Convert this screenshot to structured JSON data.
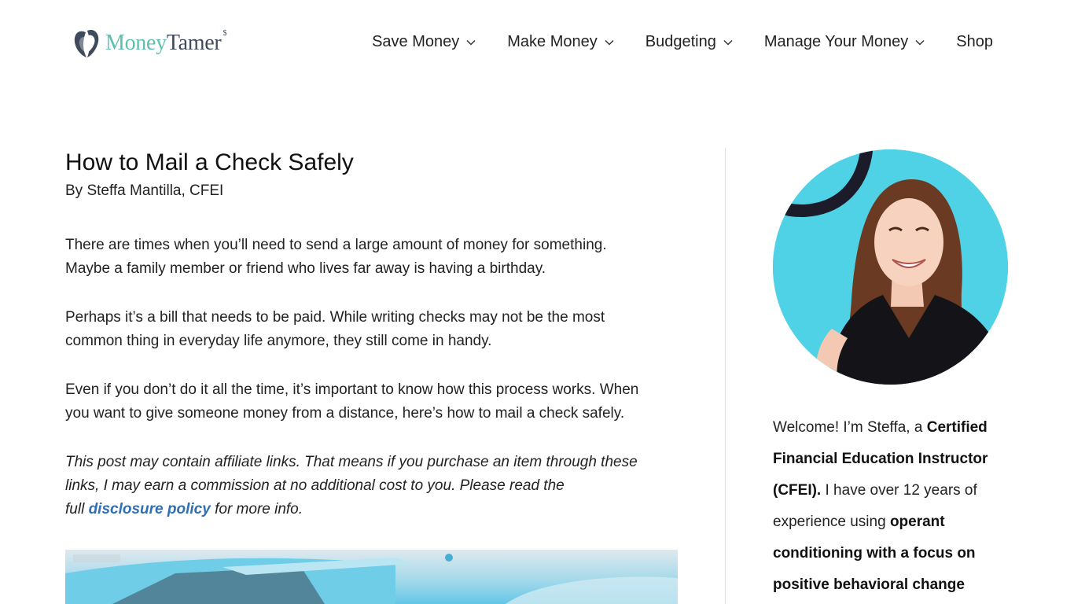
{
  "brand": {
    "name_part1": "Money",
    "name_part2": "Tamer",
    "sup": "$"
  },
  "nav": {
    "items": [
      {
        "label": "Save Money",
        "has_dropdown": true
      },
      {
        "label": "Make Money",
        "has_dropdown": true
      },
      {
        "label": "Budgeting",
        "has_dropdown": true
      },
      {
        "label": "Manage Your Money",
        "has_dropdown": true
      },
      {
        "label": "Shop",
        "has_dropdown": false
      }
    ]
  },
  "article": {
    "title": "How to Mail a Check Safely",
    "byline": "By Steffa Mantilla, CFEI",
    "p1_line1": "There are times when you’ll need to send a large amount of money for something.",
    "p1_line2": "Maybe a family member or friend who lives far away is having a birthday.",
    "p2_line1": "Perhaps it’s a bill that needs to be paid. While writing checks may not be the most",
    "p2_line2": "common thing in everyday life anymore, they still come in handy.",
    "p3_line1": "Even if you don’t do it all the time, it’s important to know how this process works. When",
    "p3_line2": "you want to give someone money from a distance, here’s how to mail a check safely.",
    "disclosure_line1": "This post may contain affiliate links. That means if you purchase an item through these",
    "disclosure_line2": "links, I may earn a commission at no additional cost to you. Please read the",
    "disclosure_prefix": "full",
    "disclosure_link": "disclosure policy",
    "disclosure_suffix": "for more info."
  },
  "sidebar": {
    "bio_t1": "Welcome! I’m Steffa, a ",
    "bio_b1": "Certified Financial Education Instructor (CFEI).",
    "bio_t2": " I have over 12 years of experience using ",
    "bio_b2": "operant conditioning with a focus on positive behavioral change"
  },
  "colors": {
    "accent_teal": "#5dbfae",
    "brand_dark": "#3f4a5c",
    "link": "#2f6fb6",
    "avatar_bg": "#4fd2e6"
  }
}
